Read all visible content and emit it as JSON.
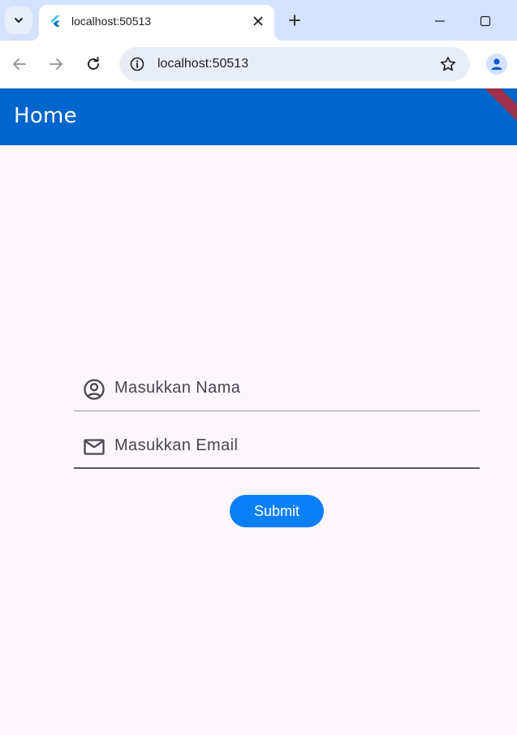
{
  "browser": {
    "tab": {
      "title": "localhost:50513"
    },
    "address_bar": {
      "url": "localhost:50513"
    },
    "colors": {
      "tabstrip": "#d3e3fd",
      "toolbar": "#ffffff",
      "omnibox": "#e9eef6"
    },
    "icons": {
      "tab_search": "chevron-down-icon",
      "favicon": "flutter-logo-icon",
      "tab_close": "close-icon",
      "new_tab": "plus-icon",
      "minimize": "minimize-icon",
      "maximize": "maximize-icon",
      "back": "arrow-left-icon",
      "forward": "arrow-right-icon",
      "reload": "reload-icon",
      "site_info": "info-icon",
      "bookmark": "star-icon",
      "profile": "person-icon"
    }
  },
  "app": {
    "appbar": {
      "title": "Home",
      "color": "#0066cc",
      "debug_banner_color": "#a0314a"
    },
    "form": {
      "name_field": {
        "placeholder": "Masukkan Nama",
        "value": "",
        "icon": "account-circle-icon"
      },
      "email_field": {
        "placeholder": "Masukkan Email",
        "value": "",
        "icon": "mail-icon"
      },
      "submit": {
        "label": "Submit",
        "color": "#0a7ff5"
      }
    },
    "background": "#fdf6fd"
  }
}
